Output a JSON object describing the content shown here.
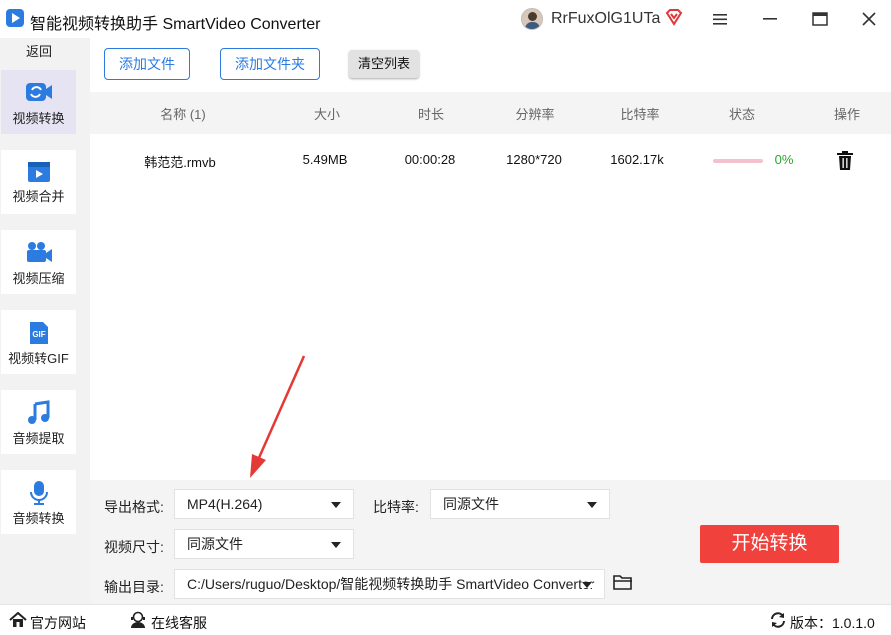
{
  "app": {
    "title": "智能视频转换助手 SmartVideo Converter",
    "username": "RrFuxOlG1UTa"
  },
  "sidebar": {
    "back_label": "返回",
    "items": [
      {
        "label": "视频转换",
        "icon": "video-convert-icon",
        "active": true
      },
      {
        "label": "视频合并",
        "icon": "video-merge-icon",
        "active": false
      },
      {
        "label": "视频压缩",
        "icon": "video-compress-icon",
        "active": false
      },
      {
        "label": "视频转GIF",
        "icon": "gif-icon",
        "active": false
      },
      {
        "label": "音频提取",
        "icon": "music-note-icon",
        "active": false
      },
      {
        "label": "音频转换",
        "icon": "microphone-icon",
        "active": false
      }
    ]
  },
  "toolbar": {
    "add_file": "添加文件",
    "add_folder": "添加文件夹",
    "clear_list": "清空列表"
  },
  "table": {
    "headers": [
      "名称 (1)",
      "大小",
      "时长",
      "分辨率",
      "比特率",
      "状态",
      "操作"
    ],
    "rows": [
      {
        "name": "韩范范.rmvb",
        "size": "5.49MB",
        "duration": "00:00:28",
        "resolution": "1280*720",
        "bitrate": "1602.17k",
        "progress": "0%",
        "progress_value": 0.0
      }
    ]
  },
  "settings": {
    "format_label": "导出格式:",
    "format_value": "MP4(H.264)",
    "bitrate_label": "比特率:",
    "bitrate_value": "同源文件",
    "size_label": "视频尺寸:",
    "size_value": "同源文件",
    "output_label": "输出目录:",
    "output_value": "C:/Users/ruguo/Desktop/智能视频转换助手 SmartVideo Converter"
  },
  "start_button": "开始转换",
  "statusbar": {
    "website": "官方网站",
    "support": "在线客服",
    "version": "版本：1.0.1.0"
  },
  "colors": {
    "accent": "#2b7be0",
    "start": "#f0413d",
    "progress_text": "#2aa52a",
    "annotation_arrow": "#e53935"
  }
}
